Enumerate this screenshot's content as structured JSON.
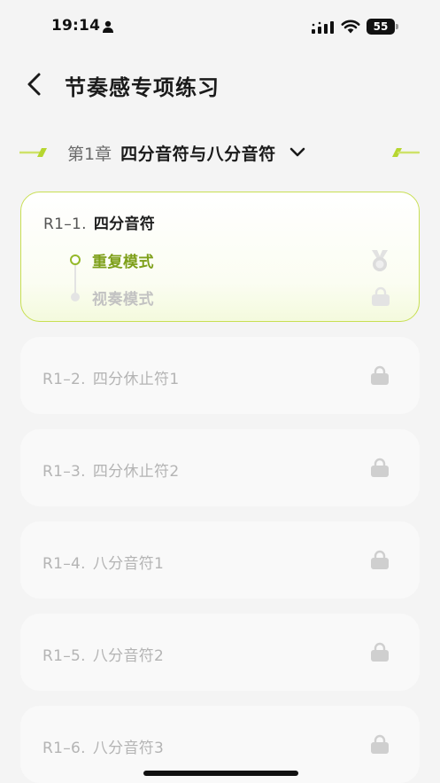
{
  "status_bar": {
    "time": "19:14",
    "battery": "55",
    "icons": [
      "person-icon",
      "signal-icon",
      "wifi-icon",
      "battery-icon"
    ]
  },
  "header": {
    "title": "节奏感专项练习",
    "back_icon": "chevron-left-icon"
  },
  "chapter": {
    "number": "第1章",
    "name": "四分音符与八分音符",
    "dropdown_icon": "chevron-down-icon"
  },
  "colors": {
    "accent": "#95b92a",
    "accent_text": "#7ea01a",
    "card_border": "#c8df52",
    "locked_text": "#b4b4b4",
    "background": "#f4f4f4"
  },
  "lessons": [
    {
      "code": "R1–1.",
      "name": "四分音符",
      "state": "active",
      "modes": [
        {
          "label": "重复模式",
          "state": "current",
          "icon": "medal-icon"
        },
        {
          "label": "视奏模式",
          "state": "locked",
          "icon": "lock-icon"
        }
      ]
    },
    {
      "code": "R1–2.",
      "name": "四分休止符1",
      "state": "locked",
      "icon": "lock-icon"
    },
    {
      "code": "R1–3.",
      "name": "四分休止符2",
      "state": "locked",
      "icon": "lock-icon"
    },
    {
      "code": "R1–4.",
      "name": "八分音符1",
      "state": "locked",
      "icon": "lock-icon"
    },
    {
      "code": "R1–5.",
      "name": "八分音符2",
      "state": "locked",
      "icon": "lock-icon"
    },
    {
      "code": "R1–6.",
      "name": "八分音符3",
      "state": "locked",
      "icon": "lock-icon"
    }
  ]
}
